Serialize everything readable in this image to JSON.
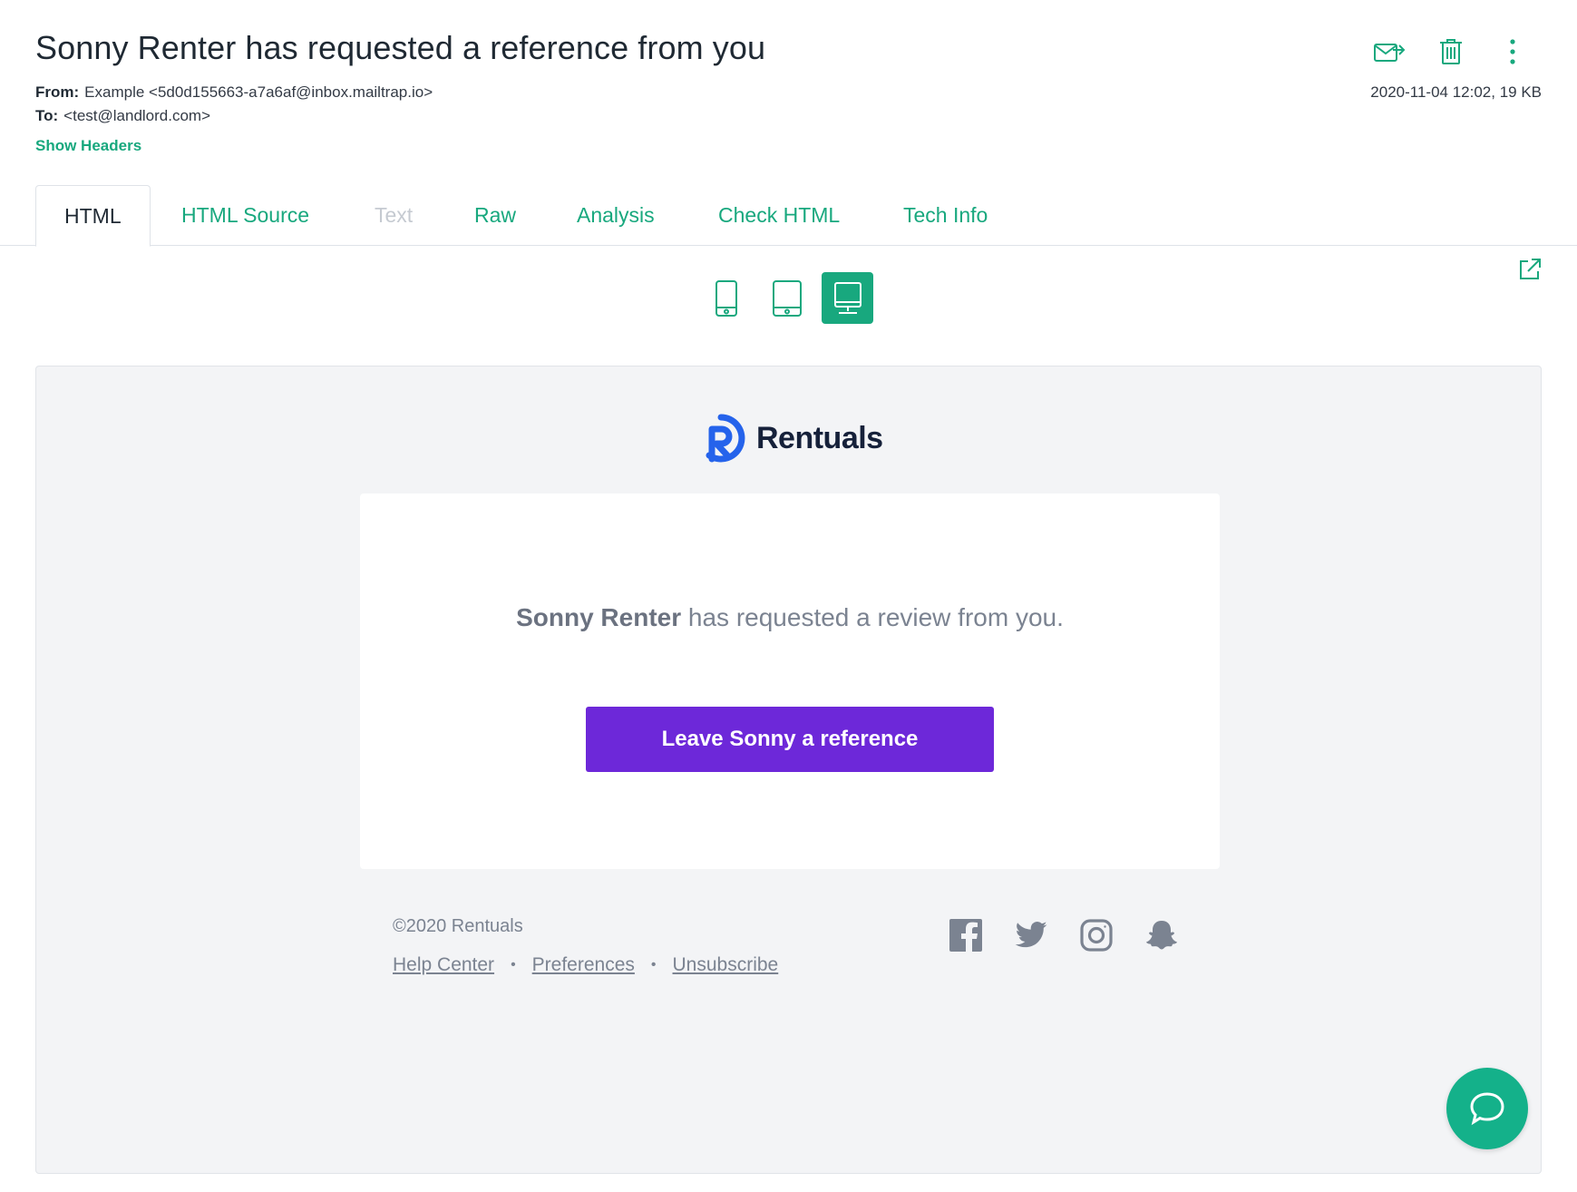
{
  "message": {
    "subject": "Sonny Renter has requested a reference from you",
    "from_label": "From:",
    "from_value": "Example <5d0d155663-a7a6af@inbox.mailtrap.io>",
    "to_label": "To:",
    "to_value": "<test@landlord.com>",
    "datetime_size": "2020-11-04 12:02, 19 KB",
    "show_headers": "Show Headers"
  },
  "tabs": [
    {
      "label": "HTML",
      "state": "active"
    },
    {
      "label": "HTML Source",
      "state": "normal"
    },
    {
      "label": "Text",
      "state": "disabled"
    },
    {
      "label": "Raw",
      "state": "normal"
    },
    {
      "label": "Analysis",
      "state": "normal"
    },
    {
      "label": "Check HTML",
      "state": "normal"
    },
    {
      "label": "Tech Info",
      "state": "normal"
    }
  ],
  "devices": [
    {
      "icon": "mobile-icon",
      "active": false
    },
    {
      "icon": "tablet-icon",
      "active": false
    },
    {
      "icon": "desktop-icon",
      "active": true
    }
  ],
  "email": {
    "brand": "Rentuals",
    "name": "Sonny Renter",
    "msg_rest": " has requested a review from you.",
    "cta_label": "Leave Sonny a reference",
    "copyright": "©2020 Rentuals",
    "links": [
      "Help Center",
      "Preferences",
      "Unsubscribe"
    ],
    "link_separator": "•"
  },
  "colors": {
    "accent": "#18a87e",
    "cta": "#6d28d9",
    "brand_blue": "#2563eb"
  }
}
